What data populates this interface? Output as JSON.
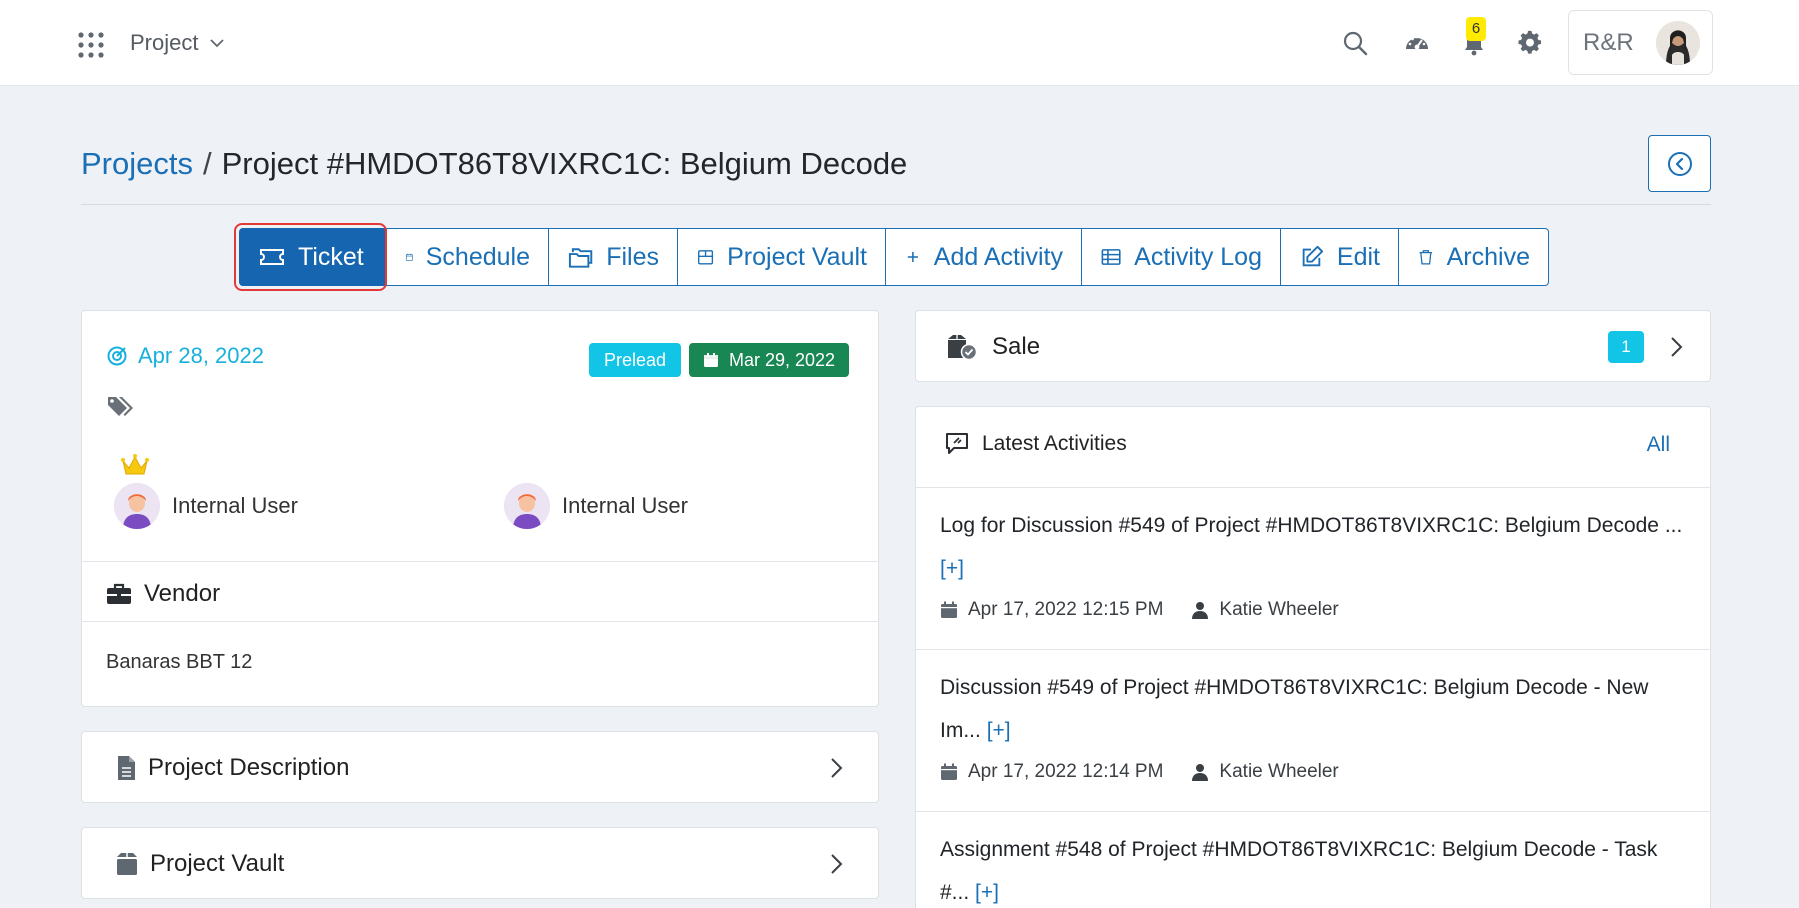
{
  "navbar": {
    "project_switcher": "Project",
    "org_name": "R&R",
    "notification_count": "6",
    "icons": [
      "apps-grid-icon",
      "chevron-down-icon",
      "search-icon",
      "dashboard-gauge-icon",
      "bell-icon",
      "gear-icon"
    ]
  },
  "breadcrumb": {
    "root": "Projects",
    "separator": "/",
    "current": "Project #HMDOT86T8VIXRC1C: Belgium Decode"
  },
  "actions": [
    {
      "label": "Ticket",
      "icon": "ticket-icon",
      "active": true
    },
    {
      "label": "Schedule",
      "icon": "calendar-icon",
      "active": false
    },
    {
      "label": "Files",
      "icon": "folders-icon",
      "active": false
    },
    {
      "label": "Project Vault",
      "icon": "archive-box-icon",
      "active": false
    },
    {
      "label": "Add Activity",
      "icon": "plus-icon",
      "active": false
    },
    {
      "label": "Activity Log",
      "icon": "table-icon",
      "active": false
    },
    {
      "label": "Edit",
      "icon": "edit-icon",
      "active": false
    },
    {
      "label": "Archive",
      "icon": "trash-icon",
      "active": false
    }
  ],
  "overview": {
    "created_date": "Apr 28, 2022",
    "status_badge": "Prelead",
    "due_date": "Mar 29, 2022",
    "users": [
      {
        "name": "Internal User",
        "owner": true
      },
      {
        "name": "Internal User",
        "owner": false
      }
    ],
    "vendor_title": "Vendor",
    "vendor_value": "Banaras BBT 12"
  },
  "sections": {
    "description": "Project Description",
    "vault": "Project Vault"
  },
  "sale": {
    "label": "Sale",
    "count": "1"
  },
  "activities": {
    "title": "Latest Activities",
    "all_link": "All",
    "items": [
      {
        "text": "Log for Discussion #549 of Project #HMDOT86T8VIXRC1C: Belgium Decode ...",
        "more": "[+]",
        "datetime": "Apr 17, 2022 12:15 PM",
        "user": "Katie Wheeler"
      },
      {
        "text": "Discussion #549 of Project #HMDOT86T8VIXRC1C: Belgium Decode - New Im...",
        "more": "[+]",
        "datetime": "Apr 17, 2022 12:14 PM",
        "user": "Katie Wheeler"
      },
      {
        "text": "Assignment #548 of Project #HMDOT86T8VIXRC1C: Belgium Decode - Task #...",
        "more": "[+]",
        "datetime": "",
        "user": ""
      }
    ]
  },
  "colors": {
    "primary": "#1a6fb5",
    "active_button": "#1565b0",
    "info_badge": "#12c4e6",
    "success_badge": "#198754",
    "highlight_ring": "#e53935",
    "notification_badge": "#ffea00"
  }
}
